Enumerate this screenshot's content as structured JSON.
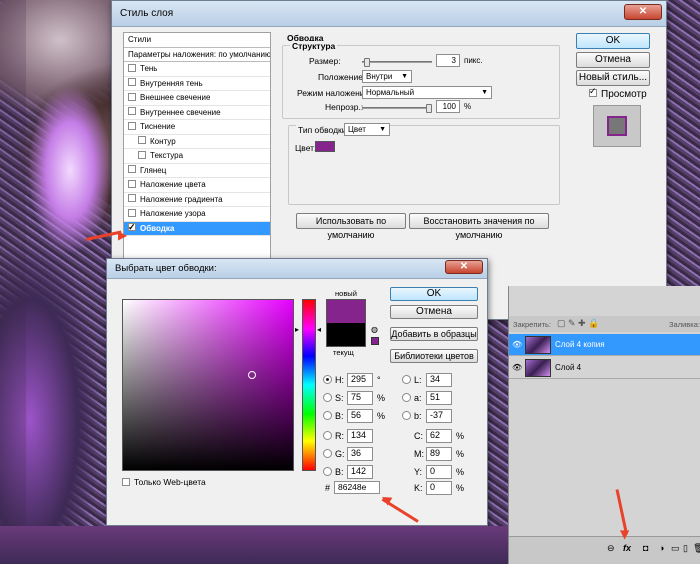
{
  "style_dialog": {
    "title": "Стиль слоя",
    "styles_header": "Стили",
    "blend_defaults": "Параметры наложения: по умолчанию",
    "items": [
      {
        "label": "Тень",
        "checked": false,
        "indent": false,
        "selected": false
      },
      {
        "label": "Внутренняя тень",
        "checked": false,
        "indent": false,
        "selected": false
      },
      {
        "label": "Внешнее свечение",
        "checked": false,
        "indent": false,
        "selected": false
      },
      {
        "label": "Внутреннее свечение",
        "checked": false,
        "indent": false,
        "selected": false
      },
      {
        "label": "Тиснение",
        "checked": false,
        "indent": false,
        "selected": false
      },
      {
        "label": "Контур",
        "checked": false,
        "indent": true,
        "selected": false
      },
      {
        "label": "Текстура",
        "checked": false,
        "indent": true,
        "selected": false
      },
      {
        "label": "Глянец",
        "checked": false,
        "indent": false,
        "selected": false
      },
      {
        "label": "Наложение цвета",
        "checked": false,
        "indent": false,
        "selected": false
      },
      {
        "label": "Наложение градиента",
        "checked": false,
        "indent": false,
        "selected": false
      },
      {
        "label": "Наложение узора",
        "checked": false,
        "indent": false,
        "selected": false
      },
      {
        "label": "Обводка",
        "checked": true,
        "indent": false,
        "selected": true
      }
    ],
    "section_title": "Обводка",
    "structure_title": "Структура",
    "size_label": "Размер:",
    "size_value": "3",
    "size_unit": "пикс.",
    "position_label": "Положение:",
    "position_value": "Внутри",
    "blend_label": "Режим наложения:",
    "blend_value": "Нормальный",
    "opacity_label": "Непрозр.:",
    "opacity_value": "100",
    "opacity_unit": "%",
    "fill_type_label": "Тип обводки:",
    "fill_type_value": "Цвет",
    "color_label": "Цвет:",
    "stroke_color": "#86248e",
    "use_default": "Использовать по умолчанию",
    "reset_default": "Восстановить значения по умолчанию",
    "ok": "OK",
    "cancel": "Отмена",
    "new_style": "Новый стиль...",
    "preview_label": "Просмотр",
    "preview_checked": true
  },
  "picker": {
    "title": "Выбрать цвет обводки:",
    "ok": "OK",
    "cancel": "Отмена",
    "add_swatch": "Добавить в образцы",
    "libraries": "Библиотеки цветов",
    "new_label": "новый",
    "current_label": "текущ",
    "new_color": "#86248e",
    "current_color": "#000000",
    "web_only": "Только Web-цвета",
    "H": {
      "label": "H:",
      "value": "295",
      "unit": "°"
    },
    "S": {
      "label": "S:",
      "value": "75",
      "unit": "%"
    },
    "Bv": {
      "label": "B:",
      "value": "56",
      "unit": "%"
    },
    "R": {
      "label": "R:",
      "value": "134"
    },
    "G": {
      "label": "G:",
      "value": "36"
    },
    "B": {
      "label": "B:",
      "value": "142"
    },
    "L": {
      "label": "L:",
      "value": "34"
    },
    "a": {
      "label": "a:",
      "value": "51"
    },
    "b": {
      "label": "b:",
      "value": "-37"
    },
    "C": {
      "label": "C:",
      "value": "62",
      "unit": "%"
    },
    "M": {
      "label": "M:",
      "value": "89",
      "unit": "%"
    },
    "Y": {
      "label": "Y:",
      "value": "0",
      "unit": "%"
    },
    "K": {
      "label": "K:",
      "value": "0",
      "unit": "%"
    },
    "hex_label": "#",
    "hex_value": "86248e"
  },
  "layers": {
    "lock_label": "Закрепить:",
    "fill_label": "Заливка:",
    "items": [
      {
        "name": "Слой 4 копия",
        "selected": true
      },
      {
        "name": "Слой 4",
        "selected": false
      }
    ],
    "footer_icons": [
      "link-icon",
      "fx-icon",
      "mask-icon",
      "adjustment-icon",
      "folder-icon",
      "new-layer-icon",
      "trash-icon"
    ]
  },
  "colors": {
    "accent": "#3399ff",
    "arrow": "#e8432a"
  }
}
